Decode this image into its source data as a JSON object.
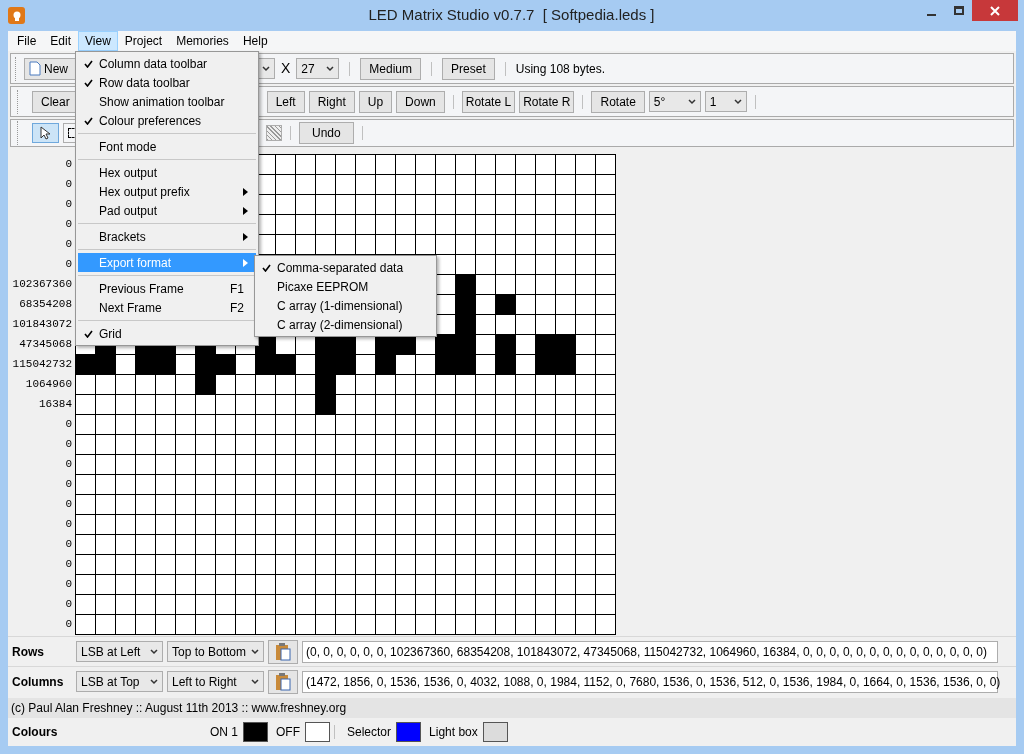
{
  "window": {
    "title": "LED Matrix Studio v0.7.7  [ Softpedia.leds ]"
  },
  "menu_bar": [
    {
      "label": "File",
      "selected": false
    },
    {
      "label": "Edit",
      "selected": false
    },
    {
      "label": "View",
      "selected": true
    },
    {
      "label": "Project",
      "selected": false
    },
    {
      "label": "Memories",
      "selected": false
    },
    {
      "label": "Help",
      "selected": false
    }
  ],
  "view_menu": [
    {
      "kind": "item",
      "label": "Column data toolbar",
      "checked": true,
      "selected": false
    },
    {
      "kind": "item",
      "label": "Row data toolbar",
      "checked": true,
      "selected": false
    },
    {
      "kind": "item",
      "label": "Show animation toolbar",
      "checked": false,
      "selected": false
    },
    {
      "kind": "item",
      "label": "Colour preferences",
      "checked": true,
      "selected": false
    },
    {
      "kind": "separator"
    },
    {
      "kind": "item",
      "label": "Font mode",
      "checked": false,
      "selected": false
    },
    {
      "kind": "separator"
    },
    {
      "kind": "item",
      "label": "Hex output",
      "checked": false,
      "selected": false
    },
    {
      "kind": "submenu",
      "label": "Hex output prefix",
      "checked": false,
      "selected": false
    },
    {
      "kind": "submenu",
      "label": "Pad output",
      "checked": false,
      "selected": false
    },
    {
      "kind": "separator"
    },
    {
      "kind": "submenu",
      "label": "Brackets",
      "checked": false,
      "selected": false
    },
    {
      "kind": "separator"
    },
    {
      "kind": "submenu",
      "label": "Export format",
      "checked": false,
      "selected": true
    },
    {
      "kind": "separator"
    },
    {
      "kind": "item",
      "label": "Previous Frame",
      "shortcut": "F1",
      "checked": false,
      "selected": false
    },
    {
      "kind": "item",
      "label": "Next Frame",
      "shortcut": "F2",
      "checked": false,
      "selected": false
    },
    {
      "kind": "separator"
    },
    {
      "kind": "item",
      "label": "Grid",
      "checked": true,
      "selected": false
    }
  ],
  "export_submenu": [
    {
      "label": "Comma-separated data",
      "checked": true
    },
    {
      "label": "Picaxe EEPROM",
      "checked": false
    },
    {
      "label": "C array (1-dimensional)",
      "checked": false
    },
    {
      "label": "C array (2-dimensional)",
      "checked": false
    }
  ],
  "toolbar_1": {
    "new": "New",
    "times": "X",
    "size": "27",
    "medium": "Medium",
    "preset": "Preset",
    "usage": "Using 108 bytes."
  },
  "toolbar_2": {
    "clear": "Clear",
    "shifts": [
      "Left",
      "Right",
      "Up",
      "Down"
    ],
    "rotates": [
      "Rotate L",
      "Rotate R"
    ],
    "rotate": "Rotate",
    "angle": "5°",
    "count": "1"
  },
  "toolbar_3": {
    "undo": "Undo"
  },
  "matrix": {
    "row_labels": [
      "0",
      "0",
      "0",
      "0",
      "0",
      "0",
      "102367360",
      "68354208",
      "101843072",
      "47345068",
      "115042732",
      "1064960",
      "16384",
      "0",
      "0",
      "0",
      "0",
      "0",
      "0",
      "0",
      "0",
      "0",
      "0",
      "0"
    ],
    "pixels": [
      {
        "on": [
          false,
          false,
          false,
          false,
          false,
          false,
          false,
          false,
          false,
          false,
          false,
          false,
          false,
          false,
          false,
          false,
          false,
          false
        ]
      },
      {
        "on": [
          false,
          false,
          false,
          false,
          false,
          false,
          false,
          false,
          false,
          false,
          false,
          false,
          false,
          false,
          false,
          false,
          false,
          false
        ]
      },
      {
        "on": [
          false,
          false,
          false,
          false,
          false,
          false,
          false,
          false,
          false,
          false,
          false,
          false,
          false,
          false,
          false,
          false,
          false,
          false
        ]
      },
      {
        "on": [
          false,
          false,
          false,
          false,
          false,
          false,
          false,
          false,
          false,
          false,
          false,
          false,
          false,
          false,
          false,
          false,
          false,
          false
        ]
      },
      {
        "on": [
          false,
          false,
          false,
          false,
          false,
          false,
          false,
          false,
          false,
          false,
          false,
          false,
          false,
          false,
          false,
          false,
          false,
          false
        ]
      },
      {
        "on": [
          false,
          false,
          false,
          false,
          false,
          false,
          false,
          false,
          false
        ]
      },
      {
        "on": [
          false,
          true,
          false,
          false,
          false,
          false,
          false,
          false,
          false
        ]
      },
      {
        "on": [
          false,
          true,
          false,
          true,
          false,
          false,
          false,
          false,
          false
        ]
      },
      {
        "on": [
          false,
          true,
          false,
          false,
          false,
          false,
          false,
          false,
          false
        ]
      },
      {
        "on": [
          false,
          true,
          false,
          true,
          true,
          false,
          true,
          false,
          false,
          true,
          false,
          false,
          true,
          true,
          false,
          true,
          true,
          false,
          true,
          true,
          false,
          true,
          false,
          true,
          true,
          false,
          false
        ]
      },
      {
        "on": [
          true,
          true,
          false,
          true,
          true,
          false,
          true,
          true,
          false,
          true,
          true,
          false,
          true,
          true,
          false,
          true,
          false,
          false,
          true,
          true,
          false,
          true,
          false,
          true,
          true,
          false,
          false
        ]
      },
      {
        "on": [
          false,
          false,
          false,
          false,
          false,
          false,
          true,
          false,
          false,
          false,
          false,
          false,
          true,
          false,
          false,
          false,
          false,
          false,
          false,
          false,
          false,
          false,
          false,
          false,
          false,
          false,
          false
        ]
      },
      {
        "on": [
          false,
          false,
          false,
          false,
          false,
          false,
          false,
          false,
          false,
          false,
          false,
          false,
          true,
          false,
          false,
          false,
          false,
          false,
          false,
          false,
          false,
          false,
          false,
          false,
          false,
          false,
          false
        ]
      },
      {
        "on": [
          false,
          false,
          false,
          false,
          false,
          false,
          false,
          false,
          false,
          false,
          false,
          false,
          false,
          false,
          false,
          false,
          false,
          false,
          false,
          false,
          false,
          false,
          false,
          false,
          false,
          false,
          false
        ]
      },
      {
        "on": [
          false,
          false,
          false,
          false,
          false,
          false,
          false,
          false,
          false,
          false,
          false,
          false,
          false,
          false,
          false,
          false,
          false,
          false,
          false,
          false,
          false,
          false,
          false,
          false,
          false,
          false,
          false
        ]
      },
      {
        "on": [
          false,
          false,
          false,
          false,
          false,
          false,
          false,
          false,
          false,
          false,
          false,
          false,
          false,
          false,
          false,
          false,
          false,
          false,
          false,
          false,
          false,
          false,
          false,
          false,
          false,
          false,
          false
        ]
      },
      {
        "on": [
          false,
          false,
          false,
          false,
          false,
          false,
          false,
          false,
          false,
          false,
          false,
          false,
          false,
          false,
          false,
          false,
          false,
          false,
          false,
          false,
          false,
          false,
          false,
          false,
          false,
          false,
          false
        ]
      },
      {
        "on": [
          false,
          false,
          false,
          false,
          false,
          false,
          false,
          false,
          false,
          false,
          false,
          false,
          false,
          false,
          false,
          false,
          false,
          false,
          false,
          false,
          false,
          false,
          false,
          false,
          false,
          false,
          false
        ]
      },
      {
        "on": [
          false,
          false,
          false,
          false,
          false,
          false,
          false,
          false,
          false,
          false,
          false,
          false,
          false,
          false,
          false,
          false,
          false,
          false,
          false,
          false,
          false,
          false,
          false,
          false,
          false,
          false,
          false
        ]
      },
      {
        "on": [
          false,
          false,
          false,
          false,
          false,
          false,
          false,
          false,
          false,
          false,
          false,
          false,
          false,
          false,
          false,
          false,
          false,
          false,
          false,
          false,
          false,
          false,
          false,
          false,
          false,
          false,
          false
        ]
      },
      {
        "on": [
          false,
          false,
          false,
          false,
          false,
          false,
          false,
          false,
          false,
          false,
          false,
          false,
          false,
          false,
          false,
          false,
          false,
          false,
          false,
          false,
          false,
          false,
          false,
          false,
          false,
          false,
          false
        ]
      },
      {
        "on": [
          false,
          false,
          false,
          false,
          false,
          false,
          false,
          false,
          false,
          false,
          false,
          false,
          false,
          false,
          false,
          false,
          false,
          false,
          false,
          false,
          false,
          false,
          false,
          false,
          false,
          false,
          false
        ]
      },
      {
        "on": [
          false,
          false,
          false,
          false,
          false,
          false,
          false,
          false,
          false,
          false,
          false,
          false,
          false,
          false,
          false,
          false,
          false,
          false,
          false,
          false,
          false,
          false,
          false,
          false,
          false,
          false,
          false
        ]
      },
      {
        "on": [
          false,
          false,
          false,
          false,
          false,
          false,
          false,
          false,
          false,
          false,
          false,
          false,
          false,
          false,
          false,
          false,
          false,
          false,
          false,
          false,
          false,
          false,
          false,
          false,
          false,
          false,
          false
        ]
      }
    ]
  },
  "data_bars": [
    {
      "label": "Rows",
      "bit_order": "LSB at Left",
      "direction": "Top to Bottom",
      "value": "(0, 0, 0, 0, 0, 0, 102367360, 68354208, 101843072, 47345068, 115042732, 1064960, 16384, 0, 0, 0, 0, 0, 0, 0, 0, 0, 0, 0, 0, 0, 0)"
    },
    {
      "label": "Columns",
      "bit_order": "LSB at Top",
      "direction": "Left to Right",
      "value": "(1472, 1856, 0, 1536, 1536, 0, 4032, 1088, 0, 1984, 1152, 0, 7680, 1536, 0, 1536, 512, 0, 1536, 1984, 0, 1664, 0, 1536, 1536, 0, 0)"
    }
  ],
  "status_bar": "(c) Paul Alan Freshney :: August 11th 2013 :: www.freshney.org",
  "colours": {
    "title": "Colours",
    "items": [
      {
        "label": "ON 1",
        "color": "#000000"
      },
      {
        "label": "OFF",
        "color": "#ffffff"
      },
      {
        "label": "Selector",
        "color": "#0000ff"
      },
      {
        "label": "Light box",
        "color": "#dcdcdc"
      }
    ]
  }
}
